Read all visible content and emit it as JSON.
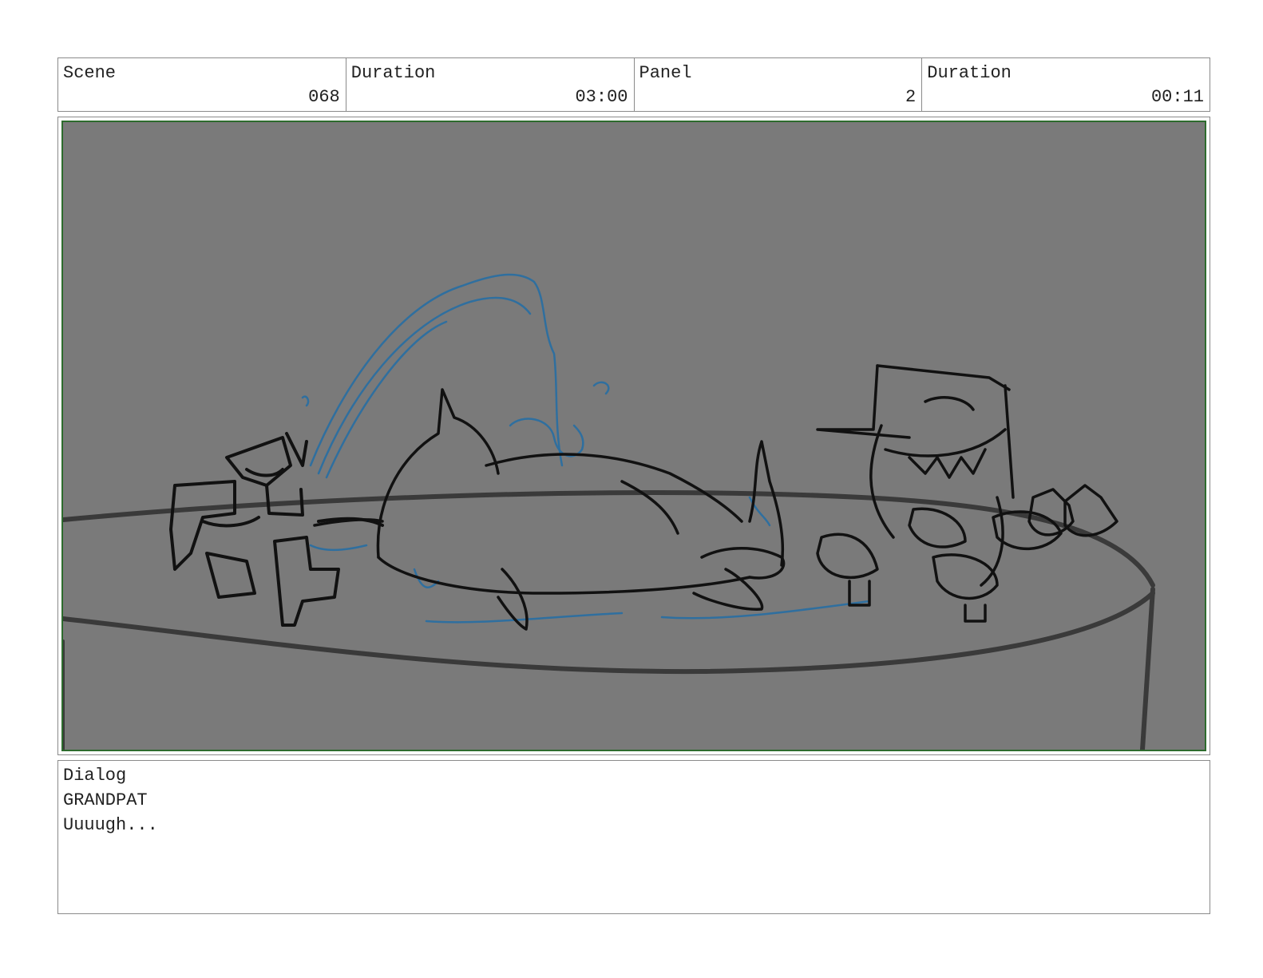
{
  "header": {
    "scene_label": "Scene",
    "scene_value": "068",
    "scene_duration_label": "Duration",
    "scene_duration_value": "03:00",
    "panel_label": "Panel",
    "panel_value": "2",
    "panel_duration_label": "Duration",
    "panel_duration_value": "00:11"
  },
  "panel": {
    "background_color": "#7a7a7a",
    "border_color": "#2d6b2d",
    "ink_color": "#111111",
    "water_color": "#2f6f9f"
  },
  "dialog": {
    "label": "Dialog",
    "character": "GRANDPAT",
    "line": "Uuuugh..."
  }
}
